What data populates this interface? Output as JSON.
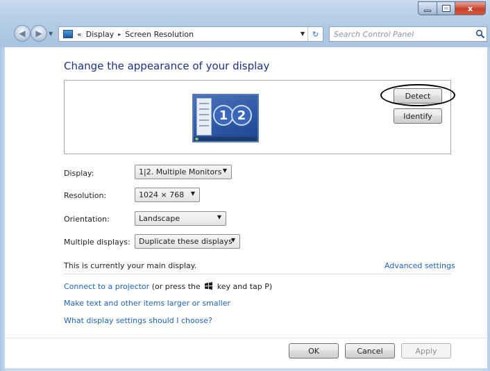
{
  "window": {
    "caption_minimize": "_",
    "caption_maximize": "□",
    "caption_close": "x"
  },
  "address_bar": {
    "crumbs": [
      "«",
      "Display",
      "Screen Resolution"
    ],
    "separator": "▸"
  },
  "search": {
    "placeholder": "Search Control Panel"
  },
  "content": {
    "heading": "Change the appearance of your display",
    "monitor_numbers": [
      "1",
      "2"
    ],
    "detect_button": "Detect",
    "identify_button": "Identify",
    "rows": [
      {
        "label": "Display:",
        "value": "1|2. Multiple Monitors"
      },
      {
        "label": "Resolution:",
        "value": "1024 × 768"
      },
      {
        "label": "Orientation:",
        "value": "Landscape"
      },
      {
        "label": "Multiple displays:",
        "value": "Duplicate these displays"
      }
    ],
    "main_display_text": "This is currently your main display.",
    "advanced_settings_link": "Advanced settings",
    "projector_link": "Connect to a projector",
    "projector_text_before": "(or press the",
    "projector_text_after": "key and tap P)",
    "links": [
      "Make text and other items larger or smaller",
      "What display settings should I choose?"
    ]
  },
  "footer": {
    "ok": "OK",
    "cancel": "Cancel",
    "apply": "Apply"
  }
}
